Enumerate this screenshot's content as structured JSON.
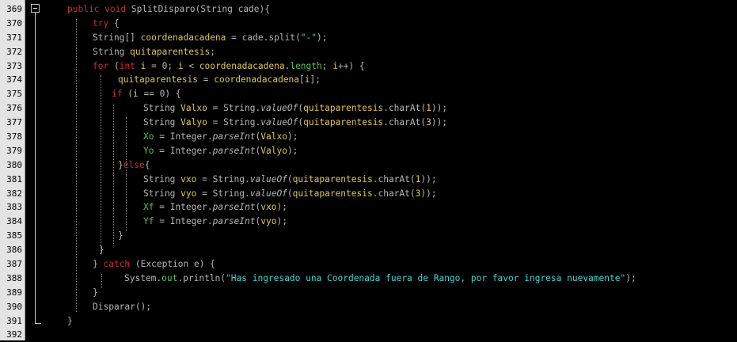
{
  "editor": {
    "lines": [
      {
        "num": "369",
        "indent": 85,
        "tokens": [
          {
            "t": "public ",
            "c": "kw"
          },
          {
            "t": "void ",
            "c": "kw"
          },
          {
            "t": "SplitDisparo",
            "c": "pn"
          },
          {
            "t": "(",
            "c": "pn"
          },
          {
            "t": "String ",
            "c": "ty"
          },
          {
            "t": "cade",
            "c": "pn"
          },
          {
            "t": "){",
            "c": "pn"
          }
        ]
      },
      {
        "num": "370",
        "indent": 117,
        "tokens": [
          {
            "t": "try ",
            "c": "kw"
          },
          {
            "t": "{",
            "c": "pn"
          }
        ]
      },
      {
        "num": "371",
        "indent": 117,
        "tokens": [
          {
            "t": "String",
            "c": "ty"
          },
          {
            "t": "[] ",
            "c": "pn"
          },
          {
            "t": "coordenadacadena",
            "c": "vr"
          },
          {
            "t": " = ",
            "c": "pn"
          },
          {
            "t": "cade",
            "c": "pn"
          },
          {
            "t": ".",
            "c": "pn"
          },
          {
            "t": "split",
            "c": "pn"
          },
          {
            "t": "(",
            "c": "pn"
          },
          {
            "t": "\"-\"",
            "c": "st"
          },
          {
            "t": ");",
            "c": "pn"
          }
        ]
      },
      {
        "num": "372",
        "indent": 117,
        "tokens": [
          {
            "t": "String ",
            "c": "ty"
          },
          {
            "t": "quitaparentesis",
            "c": "vr"
          },
          {
            "t": ";",
            "c": "pn"
          }
        ]
      },
      {
        "num": "373",
        "indent": 117,
        "tokens": [
          {
            "t": "for ",
            "c": "kw"
          },
          {
            "t": "(",
            "c": "pn"
          },
          {
            "t": "int ",
            "c": "kw"
          },
          {
            "t": "i",
            "c": "vr"
          },
          {
            "t": " = 0; ",
            "c": "pn"
          },
          {
            "t": "i",
            "c": "vr"
          },
          {
            "t": " < ",
            "c": "pn"
          },
          {
            "t": "coordenadacadena",
            "c": "vr"
          },
          {
            "t": ".",
            "c": "pn"
          },
          {
            "t": "length",
            "c": "fl"
          },
          {
            "t": "; ",
            "c": "pn"
          },
          {
            "t": "i",
            "c": "vr"
          },
          {
            "t": "++) {",
            "c": "pn"
          }
        ]
      },
      {
        "num": "374",
        "indent": 149,
        "tokens": [
          {
            "t": "quitaparentesis",
            "c": "vr"
          },
          {
            "t": " = ",
            "c": "pn"
          },
          {
            "t": "coordenadacadena",
            "c": "vr"
          },
          {
            "t": "[",
            "c": "pn"
          },
          {
            "t": "i",
            "c": "vr"
          },
          {
            "t": "];",
            "c": "pn"
          }
        ]
      },
      {
        "num": "375",
        "indent": 141,
        "tokens": [
          {
            "t": "if ",
            "c": "kw"
          },
          {
            "t": "(",
            "c": "pn"
          },
          {
            "t": "i",
            "c": "vr"
          },
          {
            "t": " == 0) {",
            "c": "pn"
          }
        ]
      },
      {
        "num": "376",
        "indent": 181,
        "tokens": [
          {
            "t": "String ",
            "c": "ty"
          },
          {
            "t": "Valxo",
            "c": "vr"
          },
          {
            "t": " = ",
            "c": "pn"
          },
          {
            "t": "String",
            "c": "ty"
          },
          {
            "t": ".",
            "c": "pn"
          },
          {
            "t": "valueOf",
            "c": "mt"
          },
          {
            "t": "(",
            "c": "pn"
          },
          {
            "t": "quitaparentesis",
            "c": "vr"
          },
          {
            "t": ".",
            "c": "pn"
          },
          {
            "t": "charAt",
            "c": "pn"
          },
          {
            "t": "(",
            "c": "pn"
          },
          {
            "t": "1",
            "c": "vr"
          },
          {
            "t": "));",
            "c": "pn"
          }
        ]
      },
      {
        "num": "377",
        "indent": 181,
        "tokens": [
          {
            "t": "String ",
            "c": "ty"
          },
          {
            "t": "Valyo",
            "c": "vr"
          },
          {
            "t": " = ",
            "c": "pn"
          },
          {
            "t": "String",
            "c": "ty"
          },
          {
            "t": ".",
            "c": "pn"
          },
          {
            "t": "valueOf",
            "c": "mt"
          },
          {
            "t": "(",
            "c": "pn"
          },
          {
            "t": "quitaparentesis",
            "c": "vr"
          },
          {
            "t": ".",
            "c": "pn"
          },
          {
            "t": "charAt",
            "c": "pn"
          },
          {
            "t": "(",
            "c": "pn"
          },
          {
            "t": "3",
            "c": "vr"
          },
          {
            "t": "));",
            "c": "pn"
          }
        ]
      },
      {
        "num": "378",
        "indent": 181,
        "tokens": [
          {
            "t": "Xo",
            "c": "fl"
          },
          {
            "t": " = ",
            "c": "pn"
          },
          {
            "t": "Integer",
            "c": "ty"
          },
          {
            "t": ".",
            "c": "pn"
          },
          {
            "t": "parseInt",
            "c": "mt"
          },
          {
            "t": "(",
            "c": "pn"
          },
          {
            "t": "Valxo",
            "c": "vr"
          },
          {
            "t": ");",
            "c": "pn"
          }
        ]
      },
      {
        "num": "379",
        "indent": 181,
        "tokens": [
          {
            "t": "Yo",
            "c": "fl"
          },
          {
            "t": " = ",
            "c": "pn"
          },
          {
            "t": "Integer",
            "c": "ty"
          },
          {
            "t": ".",
            "c": "pn"
          },
          {
            "t": "parseInt",
            "c": "mt"
          },
          {
            "t": "(",
            "c": "pn"
          },
          {
            "t": "Valyo",
            "c": "vr"
          },
          {
            "t": ");",
            "c": "pn"
          }
        ]
      },
      {
        "num": "380",
        "indent": 149,
        "tokens": [
          {
            "t": "}",
            "c": "pn"
          },
          {
            "t": "else",
            "c": "kw"
          },
          {
            "t": "{",
            "c": "pn"
          }
        ]
      },
      {
        "num": "381",
        "indent": 181,
        "tokens": [
          {
            "t": "String ",
            "c": "ty"
          },
          {
            "t": "vxo",
            "c": "vr"
          },
          {
            "t": " = ",
            "c": "pn"
          },
          {
            "t": "String",
            "c": "ty"
          },
          {
            "t": ".",
            "c": "pn"
          },
          {
            "t": "valueOf",
            "c": "mt"
          },
          {
            "t": "(",
            "c": "pn"
          },
          {
            "t": "quitaparentesis",
            "c": "vr"
          },
          {
            "t": ".",
            "c": "pn"
          },
          {
            "t": "charAt",
            "c": "pn"
          },
          {
            "t": "(",
            "c": "pn"
          },
          {
            "t": "1",
            "c": "vr"
          },
          {
            "t": "));",
            "c": "pn"
          }
        ]
      },
      {
        "num": "382",
        "indent": 181,
        "tokens": [
          {
            "t": "String ",
            "c": "ty"
          },
          {
            "t": "vyo",
            "c": "vr"
          },
          {
            "t": " = ",
            "c": "pn"
          },
          {
            "t": "String",
            "c": "ty"
          },
          {
            "t": ".",
            "c": "pn"
          },
          {
            "t": "valueOf",
            "c": "mt"
          },
          {
            "t": "(",
            "c": "pn"
          },
          {
            "t": "quitaparentesis",
            "c": "vr"
          },
          {
            "t": ".",
            "c": "pn"
          },
          {
            "t": "charAt",
            "c": "pn"
          },
          {
            "t": "(",
            "c": "pn"
          },
          {
            "t": "3",
            "c": "vr"
          },
          {
            "t": "));",
            "c": "pn"
          }
        ]
      },
      {
        "num": "383",
        "indent": 181,
        "tokens": [
          {
            "t": "Xf",
            "c": "fl"
          },
          {
            "t": " = ",
            "c": "pn"
          },
          {
            "t": "Integer",
            "c": "ty"
          },
          {
            "t": ".",
            "c": "pn"
          },
          {
            "t": "parseInt",
            "c": "mt"
          },
          {
            "t": "(",
            "c": "pn"
          },
          {
            "t": "vxo",
            "c": "vr"
          },
          {
            "t": ");",
            "c": "pn"
          }
        ]
      },
      {
        "num": "384",
        "indent": 181,
        "tokens": [
          {
            "t": "Yf",
            "c": "fl"
          },
          {
            "t": " = ",
            "c": "pn"
          },
          {
            "t": "Integer",
            "c": "ty"
          },
          {
            "t": ".",
            "c": "pn"
          },
          {
            "t": "parseInt",
            "c": "mt"
          },
          {
            "t": "(",
            "c": "pn"
          },
          {
            "t": "vyo",
            "c": "vr"
          },
          {
            "t": ");",
            "c": "pn"
          }
        ]
      },
      {
        "num": "385",
        "indent": 149,
        "tokens": [
          {
            "t": "}",
            "c": "pn"
          }
        ]
      },
      {
        "num": "386",
        "indent": 125,
        "tokens": [
          {
            "t": "}",
            "c": "pn"
          }
        ]
      },
      {
        "num": "387",
        "indent": 117,
        "tokens": [
          {
            "t": "} ",
            "c": "pn"
          },
          {
            "t": "catch ",
            "c": "kw"
          },
          {
            "t": "(",
            "c": "pn"
          },
          {
            "t": "Exception ",
            "c": "ty"
          },
          {
            "t": "e",
            "c": "pn"
          },
          {
            "t": ") {",
            "c": "pn"
          }
        ]
      },
      {
        "num": "388",
        "indent": 157,
        "tokens": [
          {
            "t": "System",
            "c": "ty"
          },
          {
            "t": ".",
            "c": "pn"
          },
          {
            "t": "out",
            "c": "fl"
          },
          {
            "t": ".",
            "c": "pn"
          },
          {
            "t": "println",
            "c": "pn"
          },
          {
            "t": "(",
            "c": "pn"
          },
          {
            "t": "\"Has ingresado una Coordenada fuera de Rango, por favor ingresa nuevamente\"",
            "c": "st"
          },
          {
            "t": ");",
            "c": "pn"
          }
        ]
      },
      {
        "num": "389",
        "indent": 117,
        "tokens": [
          {
            "t": "}",
            "c": "pn"
          }
        ]
      },
      {
        "num": "390",
        "indent": 117,
        "tokens": [
          {
            "t": "Disparar",
            "c": "pn"
          },
          {
            "t": "();",
            "c": "pn"
          }
        ]
      },
      {
        "num": "391",
        "indent": 85,
        "tokens": [
          {
            "t": "}",
            "c": "pn"
          }
        ]
      },
      {
        "num": "392",
        "indent": 85,
        "tokens": []
      }
    ],
    "colors": {
      "background": "#000000",
      "gutter": "#e4e4e4",
      "keyword": "#cc2b2b",
      "variable": "#e0c45a",
      "field": "#58c058",
      "string": "#44d2d2",
      "plain": "#b5b5b5"
    },
    "fold_icon": "minus-box-icon"
  }
}
